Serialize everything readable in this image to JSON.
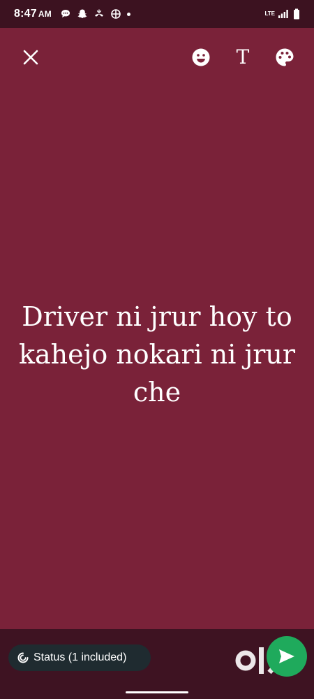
{
  "status_bar": {
    "time": "8:47",
    "ampm": "AM",
    "network": "LTE",
    "notification_icons": [
      "chat-bubble-icon",
      "snapchat-icon",
      "call-icon",
      "crosshair-icon",
      "dot-icon"
    ],
    "system_icons": [
      "lte-icon",
      "signal-icon",
      "battery-icon"
    ]
  },
  "toolbar": {
    "close_icon": "close-icon",
    "emoji_icon": "emoji-icon",
    "text_style_label": "T",
    "palette_icon": "palette-icon"
  },
  "status": {
    "text": "Driver ni jrur hoy to kahejo nokari ni jrur che",
    "background_color": "#7a2239",
    "text_color": "#ffffff"
  },
  "footer": {
    "audience_label": "Status (1 included)",
    "audience_icon": "status-ring-icon",
    "send_icon": "send-icon",
    "send_color": "#1faa5c",
    "watermark": "OLX"
  }
}
